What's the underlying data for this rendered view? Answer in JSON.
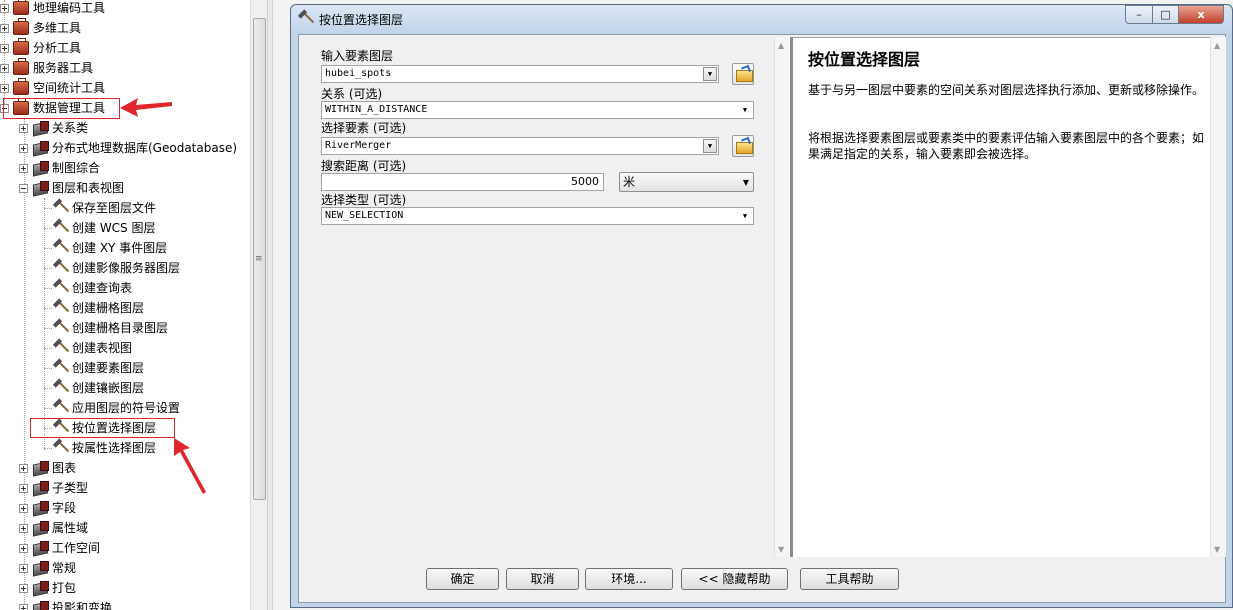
{
  "tree": {
    "toolboxes_top": [
      "地理编码工具",
      "多维工具",
      "分析工具",
      "服务器工具",
      "空间统计工具",
      "数据管理工具"
    ],
    "toolsets_a": [
      "关系类",
      "分布式地理数据库(Geodatabase)",
      "制图综合",
      "图层和表视图"
    ],
    "tools": [
      "保存至图层文件",
      "创建 WCS 图层",
      "创建 XY 事件图层",
      "创建影像服务器图层",
      "创建查询表",
      "创建栅格图层",
      "创建栅格目录图层",
      "创建表视图",
      "创建要素图层",
      "创建镶嵌图层",
      "应用图层的符号设置",
      "按位置选择图层",
      "按属性选择图层"
    ],
    "toolsets_b": [
      "图表",
      "子类型",
      "字段",
      "属性域",
      "工作空间",
      "常规",
      "打包",
      "投影和变换"
    ]
  },
  "dialog": {
    "title": "按位置选择图层",
    "params": {
      "input_label": "输入要素图层",
      "input_value": "hubei_spots",
      "relation_label": "关系 (可选)",
      "relation_value": "WITHIN_A_DISTANCE",
      "select_label": "选择要素 (可选)",
      "select_value": "RiverMerger",
      "distance_label": "搜索距离 (可选)",
      "distance_value": "5000",
      "distance_unit": "米",
      "type_label": "选择类型 (可选)",
      "type_value": "NEW_SELECTION"
    },
    "help": {
      "title": "按位置选择图层",
      "p1": "基于与另一图层中要素的空间关系对图层选择执行添加、更新或移除操作。",
      "p2": "将根据选择要素图层或要素类中的要素评估输入要素图层中的各个要素；如果满足指定的关系，输入要素即会被选择。"
    },
    "buttons": {
      "ok": "确定",
      "cancel": "取消",
      "env": "环境...",
      "hide_help": "<< 隐藏帮助",
      "tool_help": "工具帮助"
    },
    "close_glyph": "x",
    "min_glyph": "–",
    "max_glyph": "□"
  },
  "colors": {
    "highlight_red": "#e0262b",
    "title_blue": "#c3d5eb"
  }
}
